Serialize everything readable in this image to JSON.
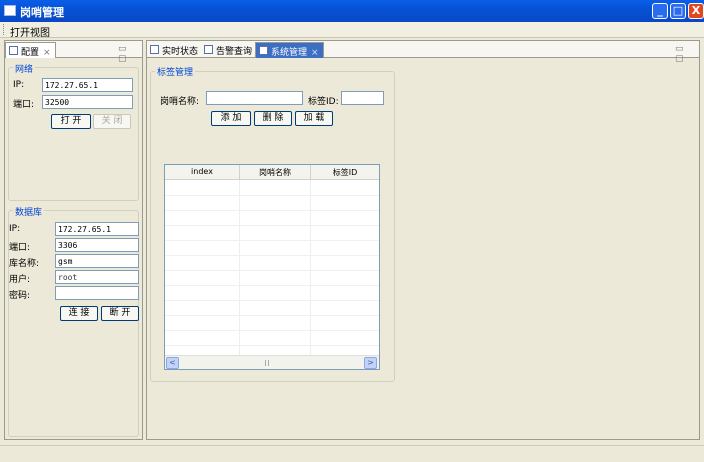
{
  "window": {
    "title": "岗哨管理",
    "controls": [
      "_",
      "□",
      "X"
    ]
  },
  "menu": {
    "items": [
      "打开视图"
    ]
  },
  "left_panel": {
    "tab": {
      "label": "配置",
      "close": "⨯"
    },
    "minmax": "▭ ▢",
    "network": {
      "legend": "网络",
      "ip_label": "IP:",
      "ip_value": "172.27.65.1",
      "port_label": "端口:",
      "port_value": "32500",
      "open_button": "打 开",
      "close_button": "关 闭"
    },
    "database": {
      "legend": "数据库",
      "ip_label": "IP:",
      "ip_value": "172.27.65.1",
      "port_label": "端口:",
      "port_value": "3306",
      "dbname_label": "库名称:",
      "dbname_value": "gsm",
      "user_label": "用户:",
      "user_value": "root",
      "password_label": "密码:",
      "password_value": "",
      "connect_button": "连 接",
      "disconnect_button": "断 开"
    }
  },
  "right_panel": {
    "tabs": [
      {
        "label": "实时状态"
      },
      {
        "label": "告警查询"
      },
      {
        "label": "系统管理",
        "close": "⨯"
      }
    ],
    "minmax": "▭ ▢",
    "tag_manage": {
      "legend": "标签管理",
      "post_name_label": "岗哨名称:",
      "post_name_value": "",
      "tag_id_label": "标签ID:",
      "tag_id_value": "",
      "add_button": "添 加",
      "delete_button": "删 除",
      "load_button": "加 载",
      "table": {
        "columns": [
          "index",
          "岗哨名称",
          "标签ID"
        ],
        "rows": []
      },
      "scroll_left": "<",
      "scroll_right": ">"
    }
  },
  "colors": {
    "titlebar": "#0553d4",
    "accent_legend": "#0046d5",
    "selected_tab": "#3c6fc4"
  }
}
